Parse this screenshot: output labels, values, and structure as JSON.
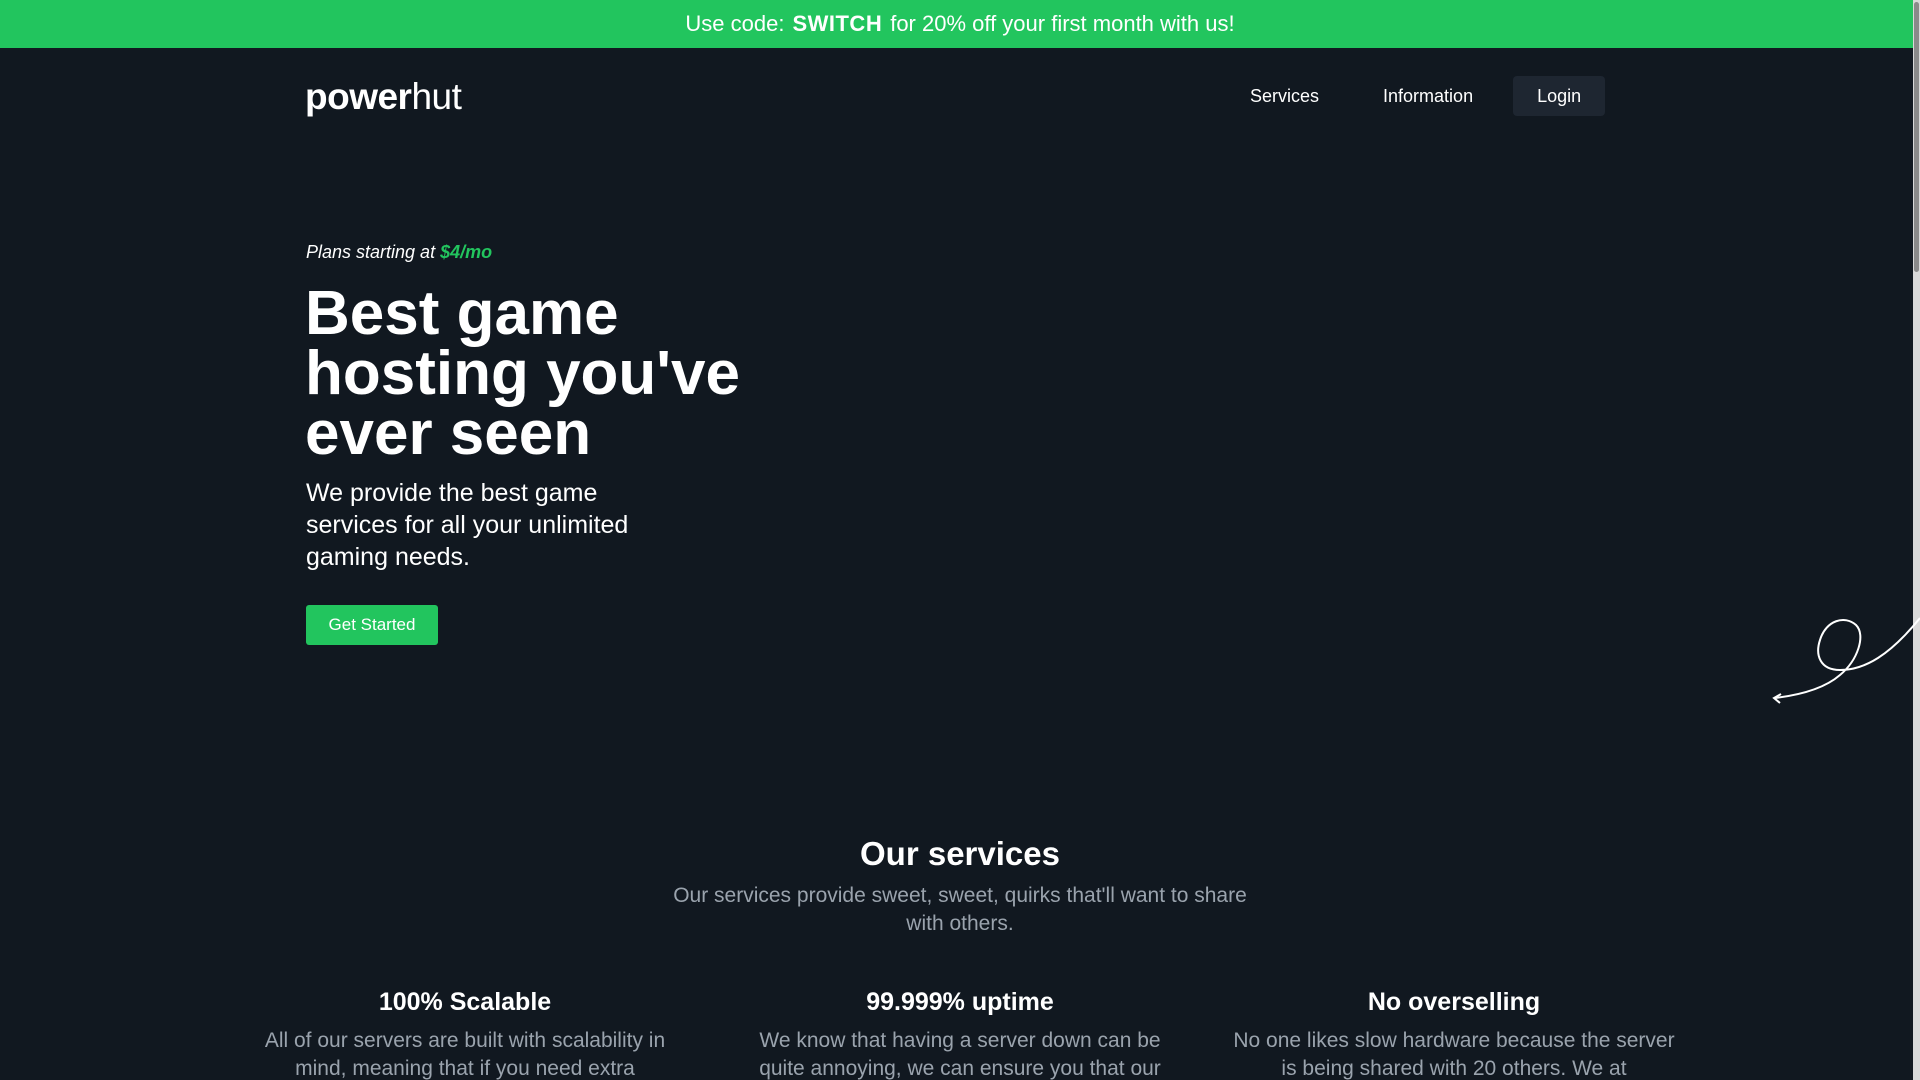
{
  "promo": {
    "prefix": "Use code:",
    "code": "SWITCH",
    "suffix": "for 20% off your first month with us!"
  },
  "header": {
    "logo_bold": "power",
    "logo_light": "hut",
    "nav": {
      "services": "Services",
      "information": "Information",
      "login": "Login"
    }
  },
  "hero": {
    "tagline_prefix": "Plans starting at",
    "tagline_price": "$4/mo",
    "title": "Best game hosting you've ever seen",
    "subtitle": "We provide the best game services for all your unlimited gaming needs.",
    "cta": "Get Started"
  },
  "services": {
    "title": "Our services",
    "subtitle": "Our services provide sweet, sweet, quirks that'll want to share with others.",
    "features": [
      {
        "title": "100% Scalable",
        "text": "All of our servers are built with scalability in mind, meaning that if you need extra"
      },
      {
        "title": "99.999% uptime",
        "text": "We know that having a server down can be quite annoying, we can ensure you that our"
      },
      {
        "title": "No overselling",
        "text": "No one likes slow hardware because the server is being shared with 20 others. We at"
      }
    ]
  },
  "colors": {
    "accent": "#22c55e",
    "background": "#111820",
    "muted_text": "#9aa3ad",
    "login_bg": "#1e2631"
  }
}
